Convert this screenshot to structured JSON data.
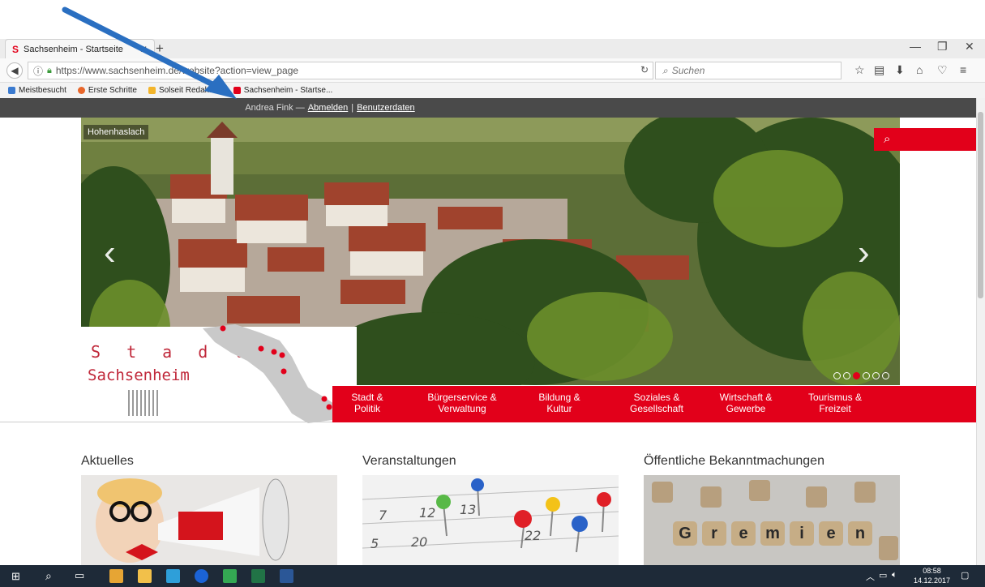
{
  "browser": {
    "tab_title": "Sachsenheim - Startseite",
    "url": "https://www.sachsenheim.de/website?action=view_page",
    "search_placeholder": "Suchen",
    "bookmarks": [
      "Meistbesucht",
      "Erste Schritte",
      "Solseit Redaktion",
      "Sachsenheim - Startse..."
    ]
  },
  "adminbar": {
    "user": "Andrea Fink —",
    "logout": "Abmelden",
    "separator": "|",
    "userdata": "Benutzerdaten"
  },
  "hero": {
    "caption": "Hohenhaslach",
    "slide_count": 6,
    "active_slide": 3
  },
  "logo": {
    "line1": "S t a d t",
    "line2": "Sachsenheim"
  },
  "nav": [
    {
      "line1": "Stadt &",
      "line2": "Politik"
    },
    {
      "line1": "Bürgerservice &",
      "line2": "Verwaltung"
    },
    {
      "line1": "Bildung &",
      "line2": "Kultur"
    },
    {
      "line1": "Soziales &",
      "line2": "Gesellschaft"
    },
    {
      "line1": "Wirtschaft &",
      "line2": "Gewerbe"
    },
    {
      "line1": "Tourismus &",
      "line2": "Freizeit"
    }
  ],
  "sections": {
    "news": "Aktuelles",
    "events": "Veranstaltungen",
    "notices": "Öffentliche Bekanntmachungen",
    "notices_tile_word": [
      "G",
      "r",
      "e",
      "m",
      "i",
      "e",
      "n"
    ]
  },
  "taskbar": {
    "time": "08:58",
    "date": "14.12.2017"
  },
  "colors": {
    "brand_red": "#e2001a",
    "annotation_arrow": "#2a6fc1"
  }
}
